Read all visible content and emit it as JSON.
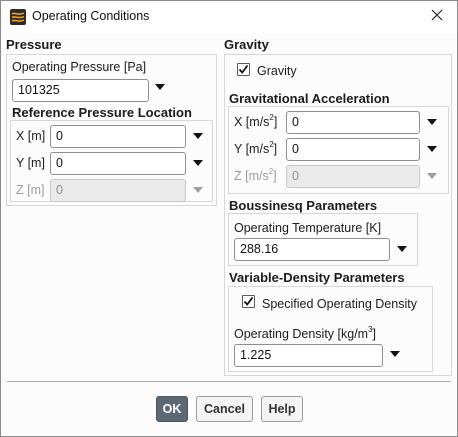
{
  "window": {
    "title": "Operating Conditions",
    "close_glyph": "✕"
  },
  "pressure": {
    "heading": "Pressure",
    "op_pressure_label": "Operating Pressure [Pa]",
    "op_pressure_value": "101325",
    "ref_location_heading": "Reference Pressure Location",
    "x_label": "X [m]",
    "x_value": "0",
    "y_label": "Y [m]",
    "y_value": "0",
    "z_label": "Z [m]",
    "z_value": "0"
  },
  "gravity": {
    "heading": "Gravity",
    "checkbox_label": "Gravity",
    "checked": true,
    "accel_heading": "Gravitational Acceleration",
    "x_label_pre": "X [m/s",
    "y_label_pre": "Y [m/s",
    "z_label_pre": "Z [m/s",
    "label_sup": "2",
    "label_post": "]",
    "x_value": "0",
    "y_value": "0",
    "z_value": "0"
  },
  "boussinesq": {
    "heading": "Boussinesq Parameters",
    "op_temp_label": "Operating Temperature [K]",
    "op_temp_value": "288.16"
  },
  "variable_density": {
    "heading": "Variable-Density Parameters",
    "checkbox_label": "Specified Operating Density",
    "checked": true,
    "op_density_label_pre": "Operating Density [kg/m",
    "op_density_label_sup": "3",
    "op_density_label_post": "]",
    "op_density_value": "1.225"
  },
  "buttons": {
    "ok": "OK",
    "cancel": "Cancel",
    "help": "Help"
  },
  "colors": {
    "default_button": "#5c6975",
    "disabled_field": "#eaeaea",
    "app_icon": "#f3a01e"
  },
  "icons": {
    "app": "ansys-fluent-icon",
    "close": "close-icon",
    "dropdown": "chevron-down-icon",
    "check": "checkmark-icon"
  }
}
